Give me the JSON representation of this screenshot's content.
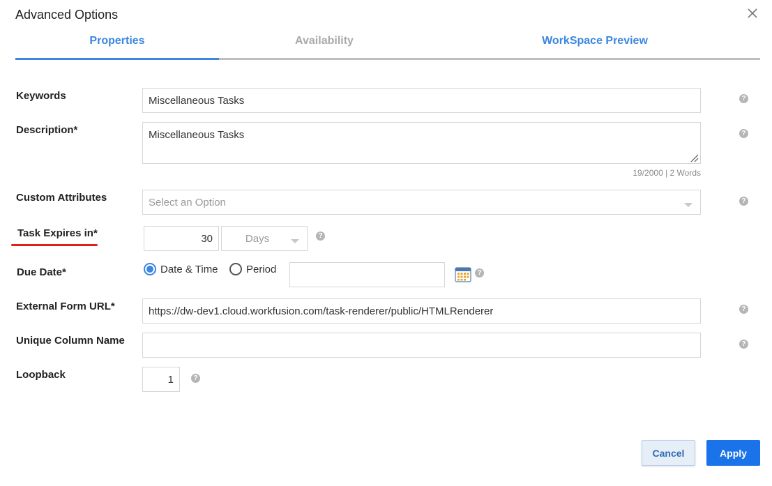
{
  "dialog": {
    "title": "Advanced Options"
  },
  "tabs": [
    {
      "label": "Properties",
      "state": "active"
    },
    {
      "label": "Availability",
      "state": "disabled"
    },
    {
      "label": "WorkSpace Preview",
      "state": "normal"
    }
  ],
  "form": {
    "keywords": {
      "label": "Keywords",
      "value": "Miscellaneous Tasks"
    },
    "description": {
      "label": "Description*",
      "value": "Miscellaneous Tasks",
      "counter": "19/2000 | 2 Words"
    },
    "custom_attributes": {
      "label": "Custom Attributes",
      "placeholder": "Select an Option"
    },
    "task_expires": {
      "label": "Task Expires in*",
      "value": "30",
      "unit": "Days"
    },
    "due_date": {
      "label": "Due Date*",
      "options": [
        "Date & Time",
        "Period"
      ],
      "selected": "Date & Time",
      "value": ""
    },
    "external_form_url": {
      "label": "External Form URL*",
      "value": "https://dw-dev1.cloud.workfusion.com/task-renderer/public/HTMLRenderer"
    },
    "unique_column_name": {
      "label": "Unique Column Name",
      "value": ""
    },
    "loopback": {
      "label": "Loopback",
      "value": "1"
    },
    "help_glyph": "?"
  },
  "footer": {
    "cancel_label": "Cancel",
    "apply_label": "Apply"
  },
  "colors": {
    "accent": "#3b86e0",
    "apply_bg": "#1a73e8",
    "highlight_underline": "#e0201b"
  },
  "icons": [
    "close-icon",
    "help-icon",
    "dropdown-caret-icon",
    "calendar-icon",
    "resize-handle-icon"
  ]
}
